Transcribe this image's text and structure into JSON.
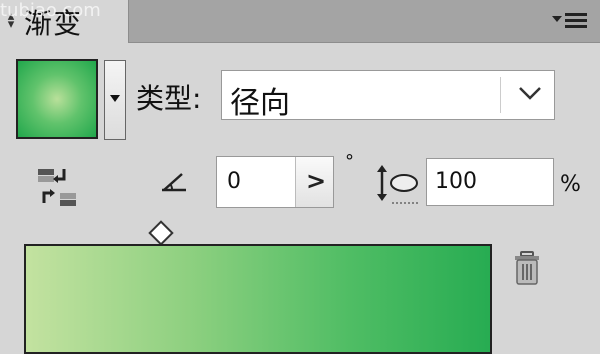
{
  "watermark": "tubiao.com",
  "panel": {
    "tab_title": "渐变",
    "tab_arrows_icon": "collapse-arrows-icon",
    "menu_icon": "panel-menu-icon"
  },
  "gradient": {
    "swatch_icon": "gradient-swatch",
    "type_label": "类型:",
    "type_value": "径向",
    "angle_value": "0",
    "angle_unit": "°",
    "aspect_value": "100",
    "aspect_unit": "%",
    "colors": {
      "start": "#c3e2a0",
      "end": "#27ac52"
    }
  }
}
